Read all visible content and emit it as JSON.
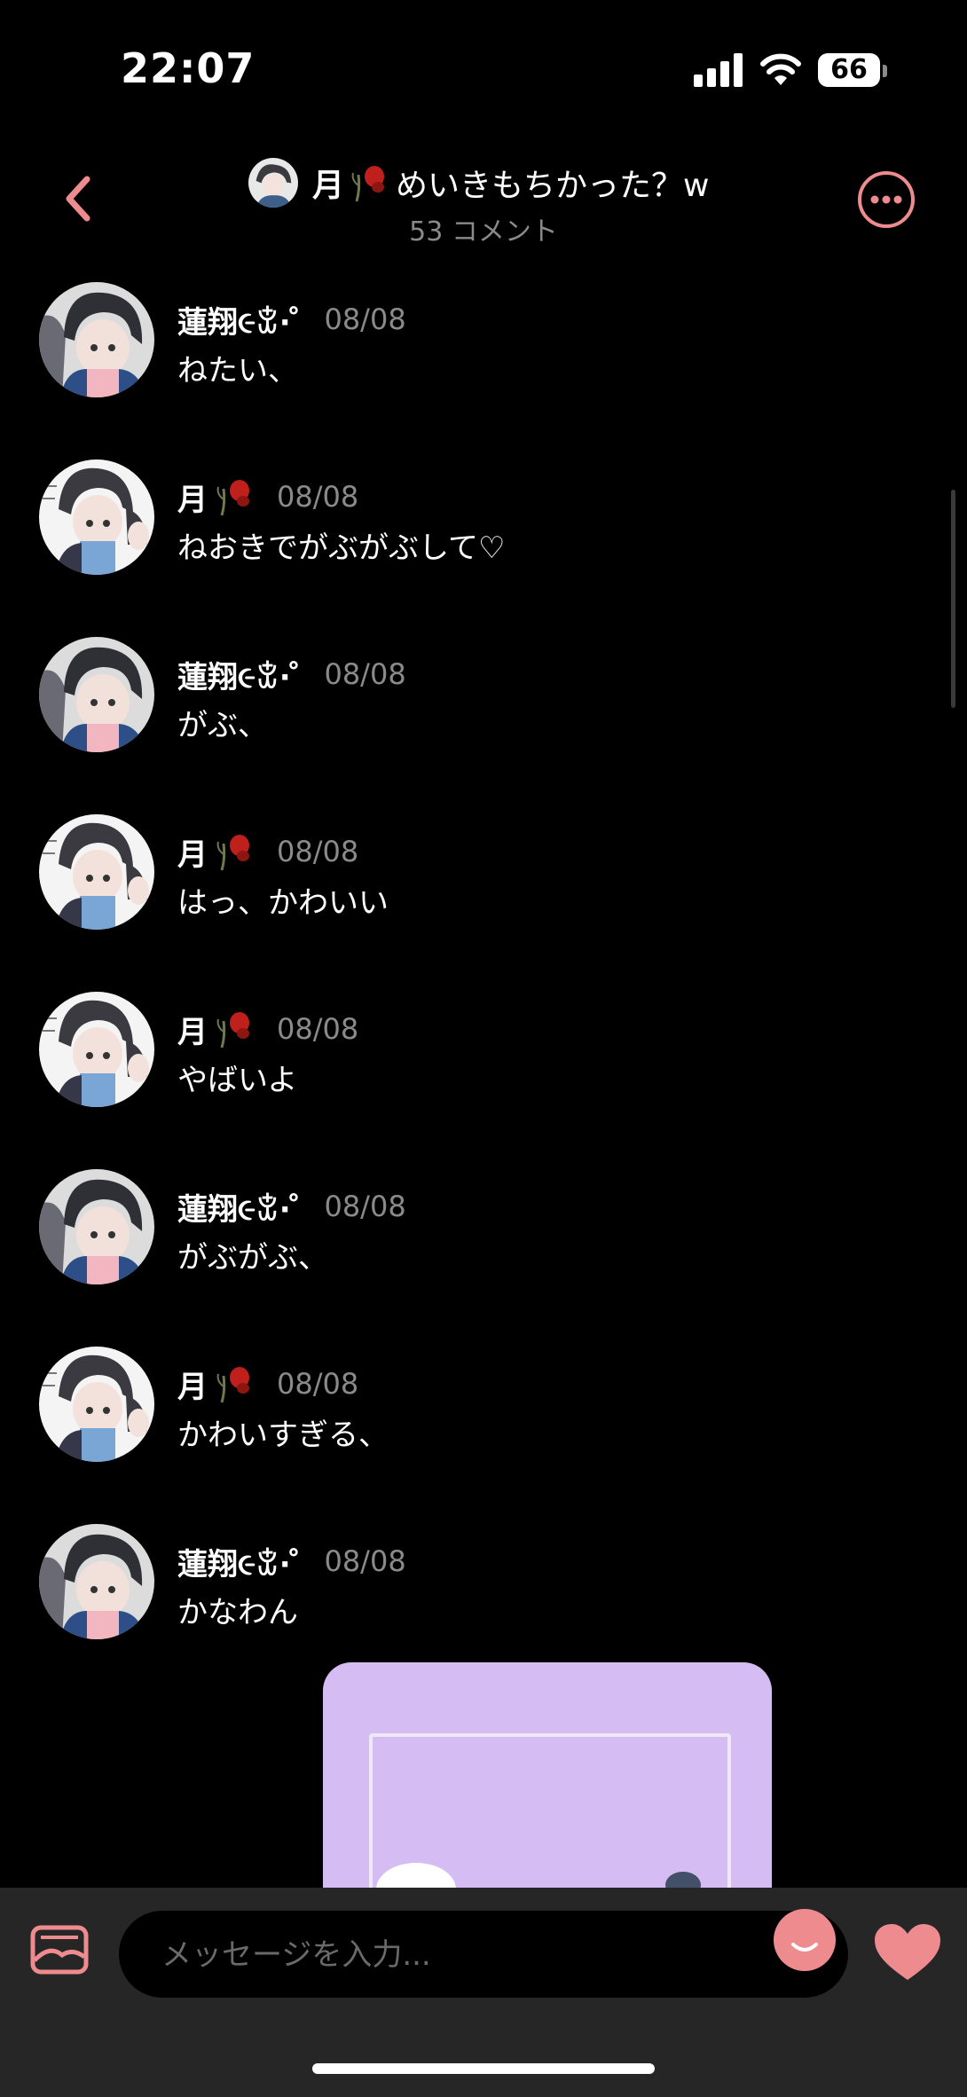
{
  "status_bar": {
    "time": "22:07",
    "battery": "66"
  },
  "header": {
    "title_name": "月",
    "title_text": "めいきもちかった？w",
    "comment_count": "53 コメント"
  },
  "messages": [
    {
      "sender": "蓮翔૯ꒃ· ̊",
      "date": "08/08",
      "text": "ねたい、",
      "avatar": "renshou"
    },
    {
      "sender": "月",
      "date": "08/08",
      "text": "ねおきでがぶがぶして♡",
      "avatar": "tsuki"
    },
    {
      "sender": "蓮翔૯ꒃ· ̊",
      "date": "08/08",
      "text": "がぶ、",
      "avatar": "renshou"
    },
    {
      "sender": "月",
      "date": "08/08",
      "text": "はっ、かわいい",
      "avatar": "tsuki"
    },
    {
      "sender": "月",
      "date": "08/08",
      "text": "やばいよ",
      "avatar": "tsuki"
    },
    {
      "sender": "蓮翔૯ꒃ· ̊",
      "date": "08/08",
      "text": "がぶがぶ、",
      "avatar": "renshou"
    },
    {
      "sender": "月",
      "date": "08/08",
      "text": "かわいすぎる、",
      "avatar": "tsuki"
    },
    {
      "sender": "蓮翔૯ꒃ· ̊",
      "date": "08/08",
      "text": "かなわん",
      "avatar": "renshou"
    }
  ],
  "composer": {
    "placeholder": "メッセージを入力..."
  },
  "colors": {
    "accent": "#ee8b8f",
    "background": "#000000",
    "bar": "#262626",
    "muted": "#8a8a8a",
    "image_bg": "#d5bdf3"
  },
  "icons": [
    "back-chevron-icon",
    "more-options-icon",
    "image-icon",
    "emoji-icon",
    "heart-icon",
    "rose-icon",
    "signal-icon",
    "wifi-icon",
    "battery-icon"
  ]
}
